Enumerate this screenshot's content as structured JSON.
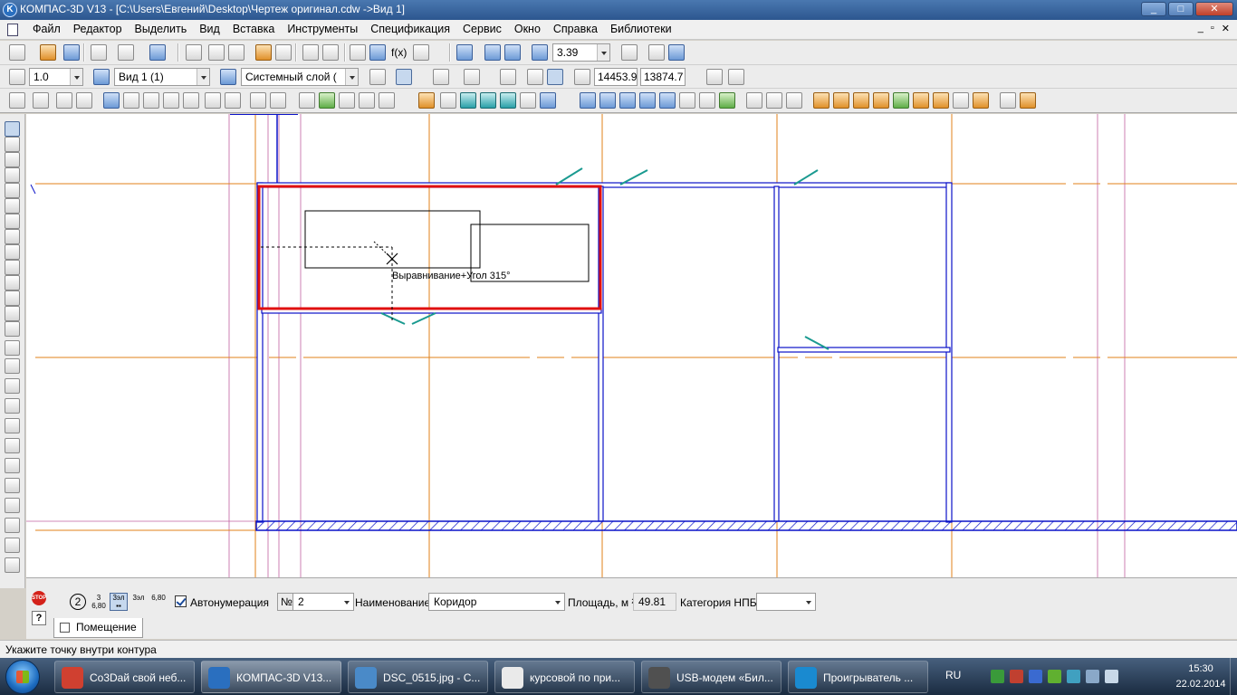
{
  "window": {
    "title": "КОМПАС-3D V13 - [C:\\Users\\Евгений\\Desktop\\Чертеж оригинал.cdw ->Вид 1]",
    "app_icon_letter": "K"
  },
  "window_controls": {
    "minimize": "_",
    "maximize": "□",
    "close": "✕"
  },
  "mdi_controls": {
    "minimize": "_",
    "restore": "▫",
    "close": "✕"
  },
  "menu": [
    "Файл",
    "Редактор",
    "Выделить",
    "Вид",
    "Вставка",
    "Инструменты",
    "Спецификация",
    "Сервис",
    "Окно",
    "Справка",
    "Библиотеки"
  ],
  "toolbar_view": {
    "zoom_value": "3.39",
    "fx_label": "f(x)"
  },
  "toolbar_current": {
    "step_value": "1.0",
    "view_value": "Вид 1 (1)",
    "layer_value": "Системный слой (",
    "coord_x": "14453.9",
    "coord_y": "13874.7"
  },
  "canvas": {
    "tooltip_text": "Выравнивание+Угол 315°",
    "colors": {
      "wall": "#0a12c8",
      "axis": "#e0801a",
      "guide": "#c060a0",
      "door": "#1a9a90",
      "selection": "#e01010"
    }
  },
  "properties": {
    "circle_num": "2",
    "mini_buttons": [
      {
        "top": "3",
        "bottom": "6,80"
      },
      {
        "top": "3эл",
        "bottom": "▪▪"
      },
      {
        "top": "3эл",
        "bottom": ""
      },
      {
        "top": "",
        "bottom": "6,80"
      }
    ],
    "autonumber_label": "Автонумерация",
    "autonumber_checked": true,
    "number_label": "№",
    "number_value": "2",
    "name_label": "Наименование",
    "name_value": "Коридор",
    "area_label": "Площадь, м ²",
    "area_value": "49.81",
    "category_label": "Категория НПБ",
    "category_value": "",
    "tab_label": "Помещение",
    "stop_label": "STOP",
    "help_label": "?"
  },
  "status": {
    "hint": "Укажите точку внутри контура"
  },
  "taskbar": {
    "tasks": [
      {
        "label": "Co3Dай свой неб...",
        "color": "#d04030"
      },
      {
        "label": "КОМПАС-3D V13...",
        "color": "#2a6fbf"
      },
      {
        "label": "DSC_0515.jpg - С...",
        "color": "#4a8ac8"
      },
      {
        "label": "курсовой по при...",
        "color": "#eaeaea"
      },
      {
        "label": "USB-модем «Бил...",
        "color": "#505050"
      },
      {
        "label": "Проигрыватель ...",
        "color": "#1a8ad0"
      }
    ],
    "language": "RU",
    "time": "15:30",
    "date": "22.02.2014"
  }
}
